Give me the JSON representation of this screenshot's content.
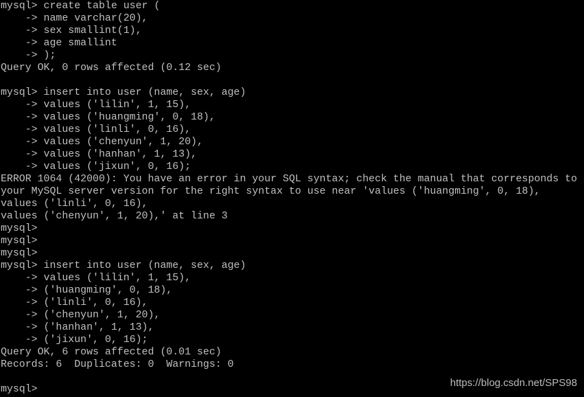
{
  "terminal": {
    "text_color": "#c0c0c0",
    "background": "#000000",
    "lines": [
      "mysql> create table user (",
      "    -> name varchar(20),",
      "    -> sex smallint(1),",
      "    -> age smallint",
      "    -> );",
      "Query OK, 0 rows affected (0.12 sec)",
      "",
      "mysql> insert into user (name, sex, age)",
      "    -> values ('lilin', 1, 15),",
      "    -> values ('huangming', 0, 18),",
      "    -> values ('linli', 0, 16),",
      "    -> values ('chenyun', 1, 20),",
      "    -> values ('hanhan', 1, 13),",
      "    -> values ('jixun', 0, 16);",
      "ERROR 1064 (42000): You have an error in your SQL syntax; check the manual that corresponds to",
      "your MySQL server version for the right syntax to use near 'values ('huangming', 0, 18),",
      "values ('linli', 0, 16),",
      "values ('chenyun', 1, 20),' at line 3",
      "mysql>",
      "mysql>",
      "mysql>",
      "mysql> insert into user (name, sex, age)",
      "    -> values ('lilin', 1, 15),",
      "    -> ('huangming', 0, 18),",
      "    -> ('linli', 0, 16),",
      "    -> ('chenyun', 1, 20),",
      "    -> ('hanhan', 1, 13),",
      "    -> ('jixun', 0, 16);",
      "Query OK, 6 rows affected (0.01 sec)",
      "Records: 6  Duplicates: 0  Warnings: 0",
      "",
      "mysql>"
    ]
  },
  "watermark": "https://blog.csdn.net/SPS98"
}
